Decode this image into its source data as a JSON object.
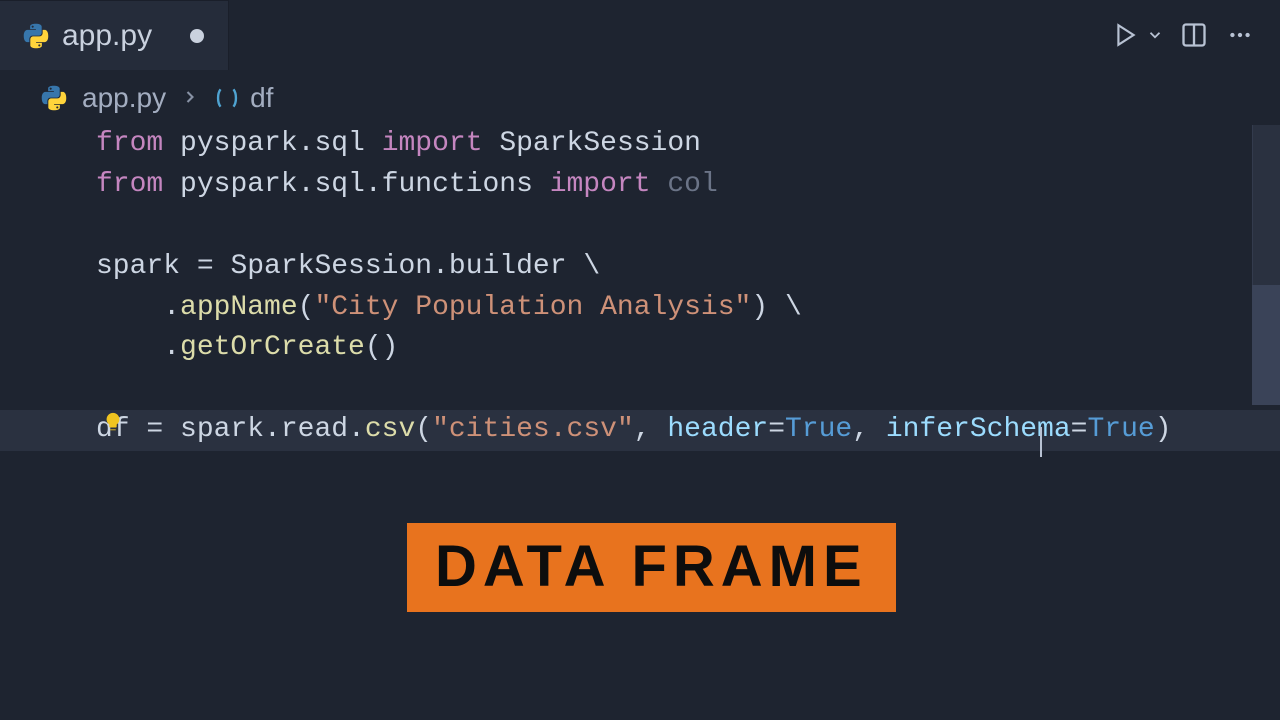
{
  "tab": {
    "filename": "app.py",
    "icon": "python-icon"
  },
  "breadcrumb": {
    "file": "app.py",
    "symbol": "df"
  },
  "code": {
    "line1": {
      "from": "from",
      "mod": "pyspark.sql",
      "import": "import",
      "name": "SparkSession"
    },
    "line2": {
      "from": "from",
      "mod": "pyspark.sql.functions",
      "import": "import",
      "name": "col"
    },
    "line4a": {
      "var": "spark",
      "eq": " = ",
      "cls": "SparkSession",
      "dot": ".",
      "prop": "builder",
      "slash": " \\"
    },
    "line4b": {
      "indent": "    .",
      "fn": "appName",
      "open": "(",
      "str": "\"City Population Analysis\"",
      "close": ")",
      "slash": " \\"
    },
    "line4c": {
      "indent": "    .",
      "fn": "getOrCreate",
      "parens": "()"
    },
    "line8": {
      "var": "df",
      "eq": " = ",
      "obj": "spark.read.",
      "fn": "csv",
      "open": "(",
      "str": "\"cities.csv\"",
      "c1": ", ",
      "p1": "header",
      "e1": "=",
      "v1": "True",
      "c2": ", ",
      "p2": "inferSchema",
      "e2": "=",
      "v2": "True",
      "close": ")"
    }
  },
  "overlay": {
    "badge_text": "DATA FRAME"
  }
}
